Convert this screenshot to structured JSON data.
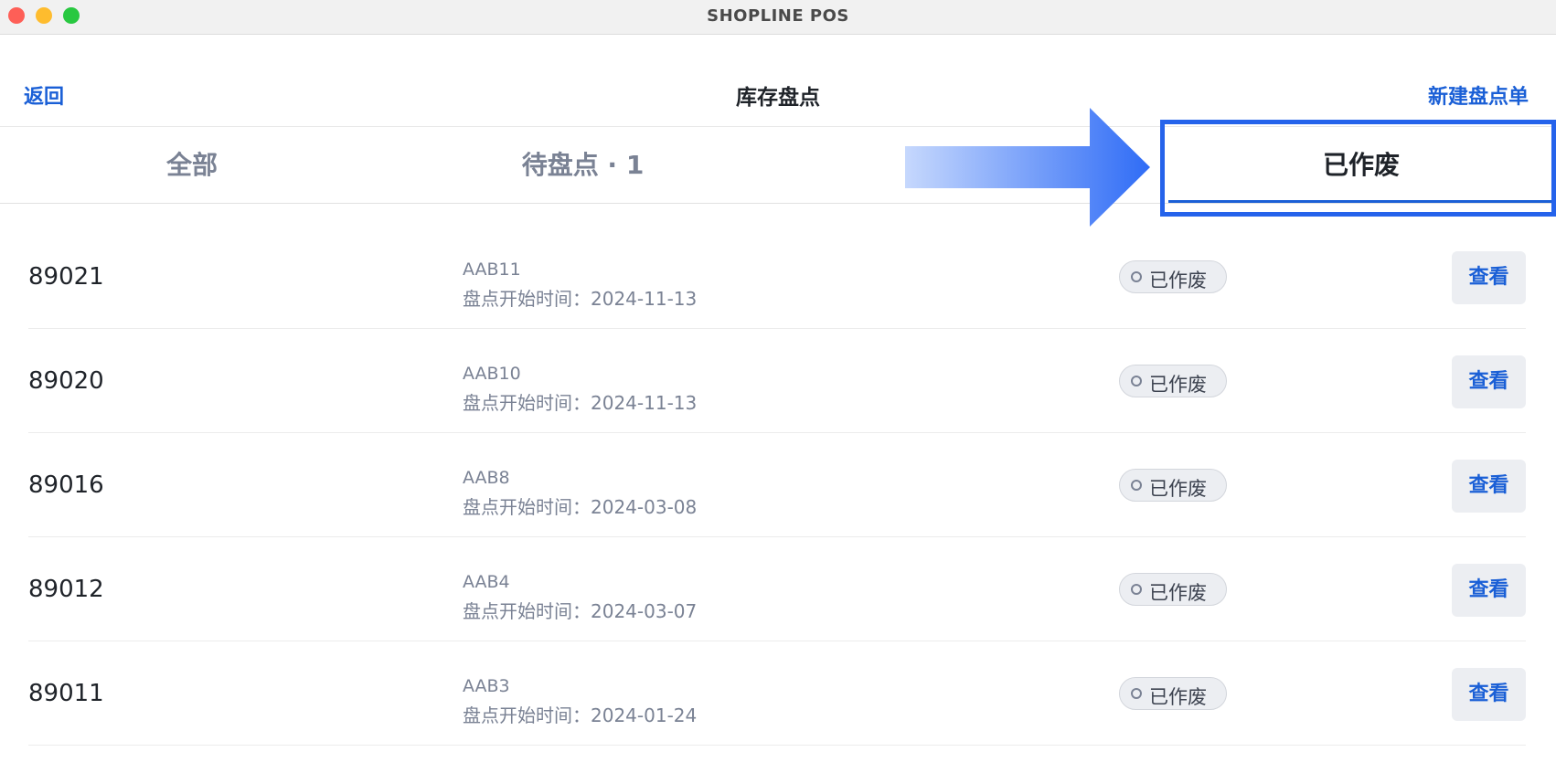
{
  "window": {
    "title": "SHOPLINE POS"
  },
  "header": {
    "back_label": "返回",
    "title": "库存盘点",
    "new_label": "新建盘点单"
  },
  "tabs": [
    {
      "label": "全部"
    },
    {
      "label": "待盘点 · 1"
    },
    {
      "label": "已作废"
    }
  ],
  "annotation": {
    "arrow_color": "#2f6cf6",
    "highlight_color": "#2563eb"
  },
  "rows": [
    {
      "id": "89021",
      "code": "AAB11",
      "date": "盘点开始时间：2024-11-13",
      "status": "已作废",
      "action": "查看"
    },
    {
      "id": "89020",
      "code": "AAB10",
      "date": "盘点开始时间：2024-11-13",
      "status": "已作废",
      "action": "查看"
    },
    {
      "id": "89016",
      "code": "AAB8",
      "date": "盘点开始时间：2024-03-08",
      "status": "已作废",
      "action": "查看"
    },
    {
      "id": "89012",
      "code": "AAB4",
      "date": "盘点开始时间：2024-03-07",
      "status": "已作废",
      "action": "查看"
    },
    {
      "id": "89011",
      "code": "AAB3",
      "date": "盘点开始时间：2024-01-24",
      "status": "已作废",
      "action": "查看"
    }
  ]
}
